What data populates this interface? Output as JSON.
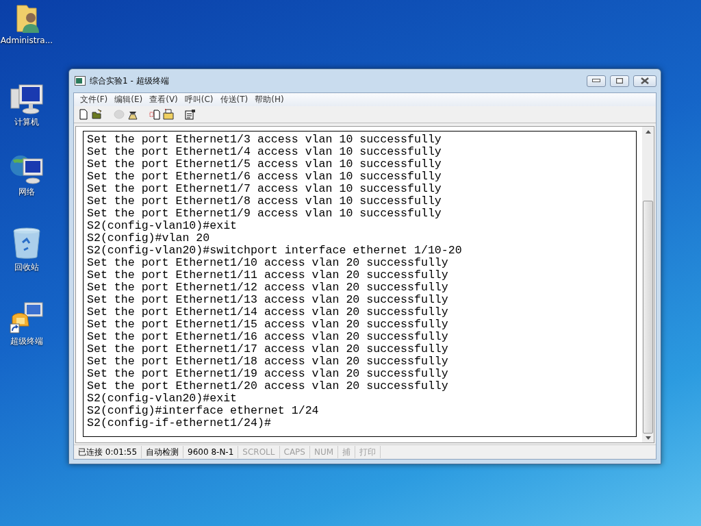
{
  "desktop_icons": [
    {
      "kind": "user-folder",
      "label": "Administra..."
    },
    {
      "kind": "computer",
      "label": "计算机"
    },
    {
      "kind": "network",
      "label": "网络"
    },
    {
      "kind": "recycle-bin",
      "label": "回收站"
    },
    {
      "kind": "terminal-shortcut",
      "label": "超级终端"
    }
  ],
  "window": {
    "title": "综合实验1 - 超级终端"
  },
  "menu": [
    "文件(F)",
    "编辑(E)",
    "查看(V)",
    "呼叫(C)",
    "传送(T)",
    "帮助(H)"
  ],
  "toolbar": [
    {
      "kind": "new",
      "disabled": false
    },
    {
      "kind": "open",
      "disabled": false
    },
    {
      "kind": "call",
      "disabled": true
    },
    {
      "kind": "hangup",
      "disabled": false
    },
    {
      "kind": "send",
      "disabled": false
    },
    {
      "kind": "receive",
      "disabled": false
    },
    {
      "kind": "properties",
      "disabled": false
    }
  ],
  "terminal_lines": [
    "Set the port Ethernet1/3 access vlan 10 successfully",
    "Set the port Ethernet1/4 access vlan 10 successfully",
    "Set the port Ethernet1/5 access vlan 10 successfully",
    "Set the port Ethernet1/6 access vlan 10 successfully",
    "Set the port Ethernet1/7 access vlan 10 successfully",
    "Set the port Ethernet1/8 access vlan 10 successfully",
    "Set the port Ethernet1/9 access vlan 10 successfully",
    "S2(config-vlan10)#exit",
    "S2(config)#vlan 20",
    "S2(config-vlan20)#switchport interface ethernet 1/10-20",
    "Set the port Ethernet1/10 access vlan 20 successfully",
    "Set the port Ethernet1/11 access vlan 20 successfully",
    "Set the port Ethernet1/12 access vlan 20 successfully",
    "Set the port Ethernet1/13 access vlan 20 successfully",
    "Set the port Ethernet1/14 access vlan 20 successfully",
    "Set the port Ethernet1/15 access vlan 20 successfully",
    "Set the port Ethernet1/16 access vlan 20 successfully",
    "Set the port Ethernet1/17 access vlan 20 successfully",
    "Set the port Ethernet1/18 access vlan 20 successfully",
    "Set the port Ethernet1/19 access vlan 20 successfully",
    "Set the port Ethernet1/20 access vlan 20 successfully",
    "S2(config-vlan20)#exit",
    "S2(config)#interface ethernet 1/24",
    "S2(config-if-ethernet1/24)#"
  ],
  "status_bar": {
    "connection": "已连接 0:01:55",
    "detection": "自动检测",
    "port_settings": "9600 8-N-1",
    "indicators": [
      {
        "label": "SCROLL",
        "on": false
      },
      {
        "label": "CAPS",
        "on": false
      },
      {
        "label": "NUM",
        "on": false
      },
      {
        "label": "捕",
        "on": false
      },
      {
        "label": "打印",
        "on": false
      }
    ]
  }
}
